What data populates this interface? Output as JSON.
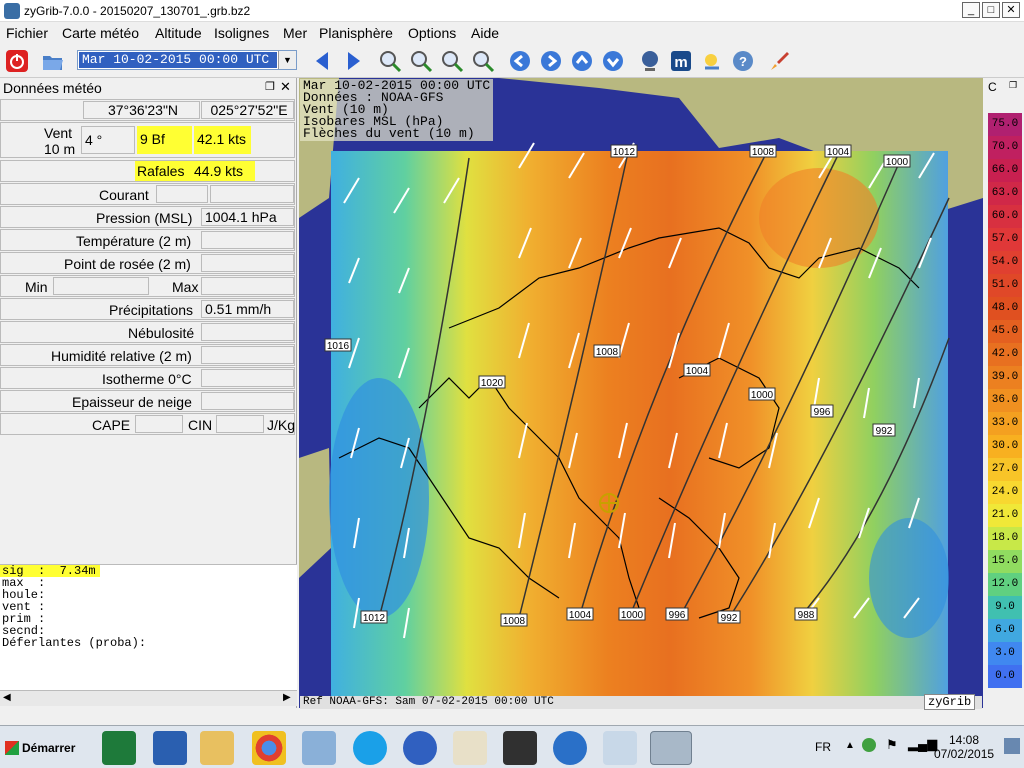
{
  "window": {
    "title": "zyGrib-7.0.0 - 20150207_130701_.grb.bz2",
    "min": "_",
    "max": "□",
    "close": "✕"
  },
  "menu": {
    "items": [
      "Fichier",
      "Carte météo",
      "Altitude",
      "Isolignes",
      "Mer",
      "Planisphère",
      "Options",
      "Aide"
    ]
  },
  "toolbar": {
    "date_value": "Mar 10-02-2015 00:00 UTC"
  },
  "panel": {
    "title": "Données météo",
    "lat": "37°36'23\"N",
    "lon": "025°27'52\"E",
    "vent_label": "Vent",
    "vent_sub": "10 m",
    "vent_dir": "4 °",
    "vent_bf": "9 Bf",
    "vent_kts": "42.1  kts",
    "rafales_label": "Rafales",
    "rafales_value": "44.9  kts",
    "courant": "Courant",
    "pression_label": "Pression (MSL)",
    "pression_value": "1004.1 hPa",
    "temperature": "Température (2 m)",
    "rosee": "Point de rosée (2 m)",
    "min": "Min",
    "max": "Max",
    "precip_label": "Précipitations",
    "precip_value": "0.51 mm/h",
    "nebulosite": "Nébulosité",
    "humidite": "Humidité relative (2 m)",
    "isotherme": "Isotherme 0°C",
    "neige": "Epaisseur de neige",
    "cape": "CAPE",
    "cin": "CIN",
    "jkg": "J/Kg"
  },
  "textlog": {
    "lines": [
      "sig  :  7.34m",
      "max  :",
      "houle:",
      "vent :",
      "prim :",
      "secnd:",
      "Déferlantes (proba):"
    ]
  },
  "map": {
    "info": [
      "Mar 10-02-2015 00:00 UTC",
      "Données : NOAA-GFS",
      "Vent (10 m)",
      "Isobares MSL (hPa)",
      "Flèches du vent (10 m)"
    ],
    "ref": "Ref NOAA-GFS: Sam 07-02-2015 00:00 UTC",
    "brand": "zyGrib",
    "isobars": [
      "1012",
      "1008",
      "1004",
      "1000",
      "1016",
      "1020",
      "1008",
      "1004",
      "1000",
      "996",
      "992",
      "1012",
      "1008",
      "1004",
      "1000",
      "996",
      "992",
      "988"
    ]
  },
  "legend": {
    "header": "C",
    "values": [
      "75.0",
      "70.0",
      "66.0",
      "63.0",
      "60.0",
      "57.0",
      "54.0",
      "51.0",
      "48.0",
      "45.0",
      "42.0",
      "39.0",
      "36.0",
      "33.0",
      "30.0",
      "27.0",
      "24.0",
      "21.0",
      "18.0",
      "15.0",
      "12.0",
      "9.0",
      "6.0",
      "3.0",
      "0.0"
    ],
    "colors": [
      "#b02070",
      "#c02060",
      "#c82050",
      "#d02848",
      "#d83040",
      "#e03838",
      "#e04030",
      "#e04828",
      "#e05020",
      "#e46020",
      "#e87020",
      "#ec8020",
      "#f09020",
      "#f4a020",
      "#f8b020",
      "#f8c428",
      "#f8d830",
      "#f0e838",
      "#c8e848",
      "#90dc60",
      "#60d080",
      "#40c0b0",
      "#40a8e0",
      "#4088f0",
      "#4070f0"
    ]
  },
  "taskbar": {
    "start": "Démarrer",
    "lang": "FR",
    "time": "14:08",
    "date": "07/02/2015"
  }
}
